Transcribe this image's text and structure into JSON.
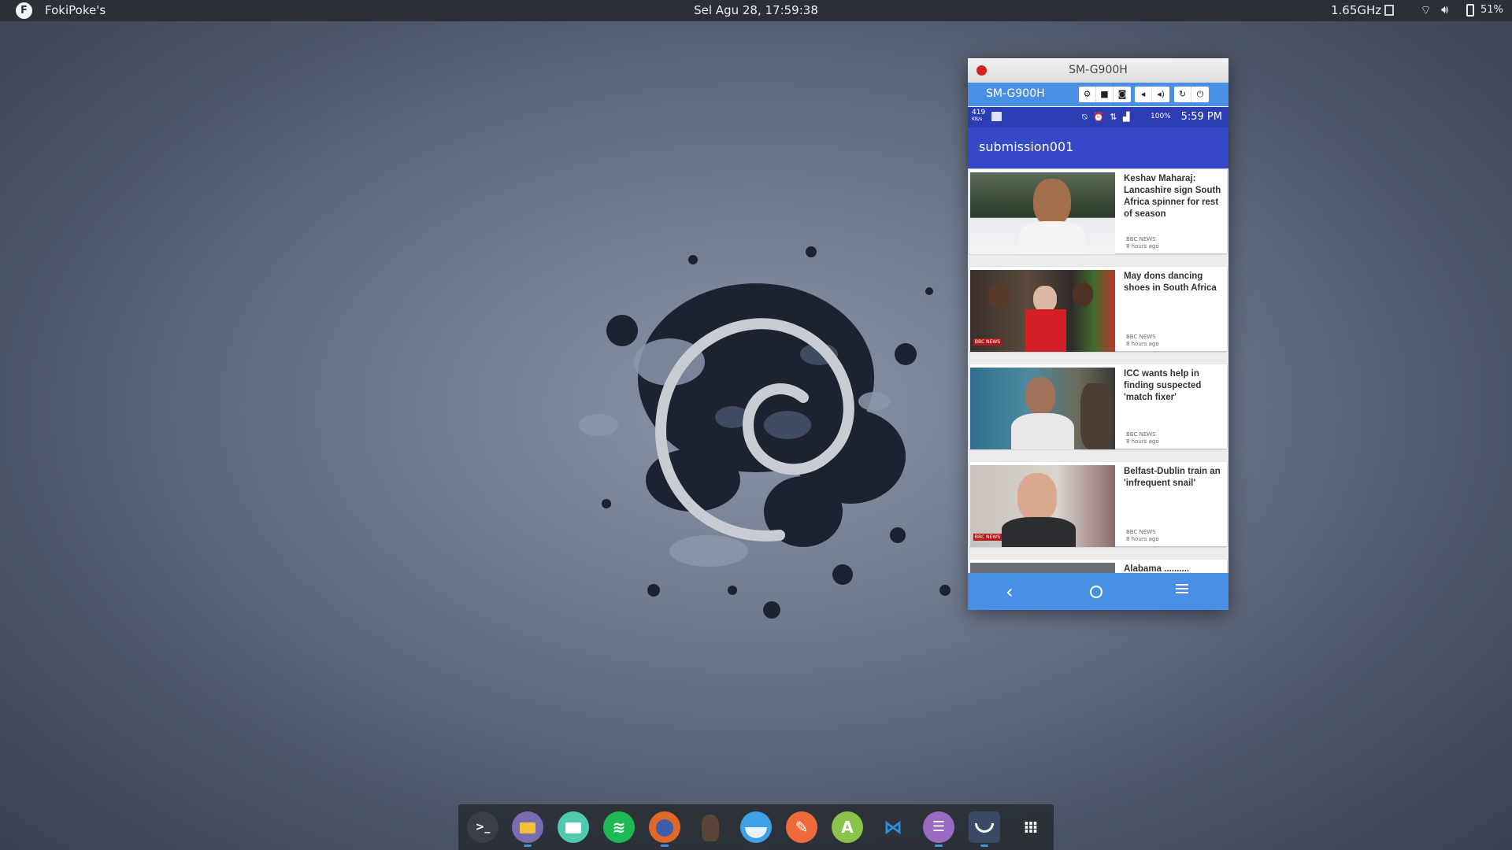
{
  "topbar": {
    "app_name": "FokiPoke's",
    "clock": "Sel Agu 28, 17:59:38",
    "cpu": "1.65GHz",
    "battery": "51%",
    "icons": [
      "menu-logo-icon",
      "cpu-icon",
      "wifi-icon",
      "volume-icon",
      "battery-icon"
    ]
  },
  "phone_window": {
    "title": "SM-G900H",
    "toolbar": {
      "device_name": "SM-G900H",
      "buttons": [
        "settings",
        "record",
        "screenshot",
        "volume-down",
        "volume-up",
        "rotate",
        "power"
      ]
    },
    "status_bar": {
      "speed": "419",
      "speed_unit": "KB/s",
      "battery": "100%",
      "time": "5:59 PM"
    },
    "app_title": "submission001",
    "news": [
      {
        "headline": "Keshav Maharaj: Lancashire sign South Africa spinner for rest of season",
        "source": "BBC NEWS",
        "time": "8 hours ago"
      },
      {
        "headline": "May dons dancing shoes in South Africa",
        "source": "BBC NEWS",
        "time": "8 hours ago"
      },
      {
        "headline": "ICC wants help in finding suspected 'match fixer'",
        "source": "BBC NEWS",
        "time": "8 hours ago"
      },
      {
        "headline": "Belfast-Dublin train an 'infrequent snail'",
        "source": "BBC NEWS",
        "time": "8 hours ago"
      },
      {
        "headline": "Alabama ..........",
        "source": "",
        "time": ""
      }
    ],
    "navbar": [
      "back",
      "home",
      "menu"
    ]
  },
  "dock": {
    "apps": [
      "terminal",
      "files",
      "mail",
      "spotify",
      "firefox",
      "gimp",
      "browser",
      "sketch",
      "android-studio",
      "vscode",
      "text-editor",
      "screenshot",
      "app-grid"
    ]
  },
  "colors": {
    "accent": "#4a8fe6",
    "app_bar": "#3548c7",
    "status_bar": "#2c3db4",
    "close": "#d32020"
  }
}
